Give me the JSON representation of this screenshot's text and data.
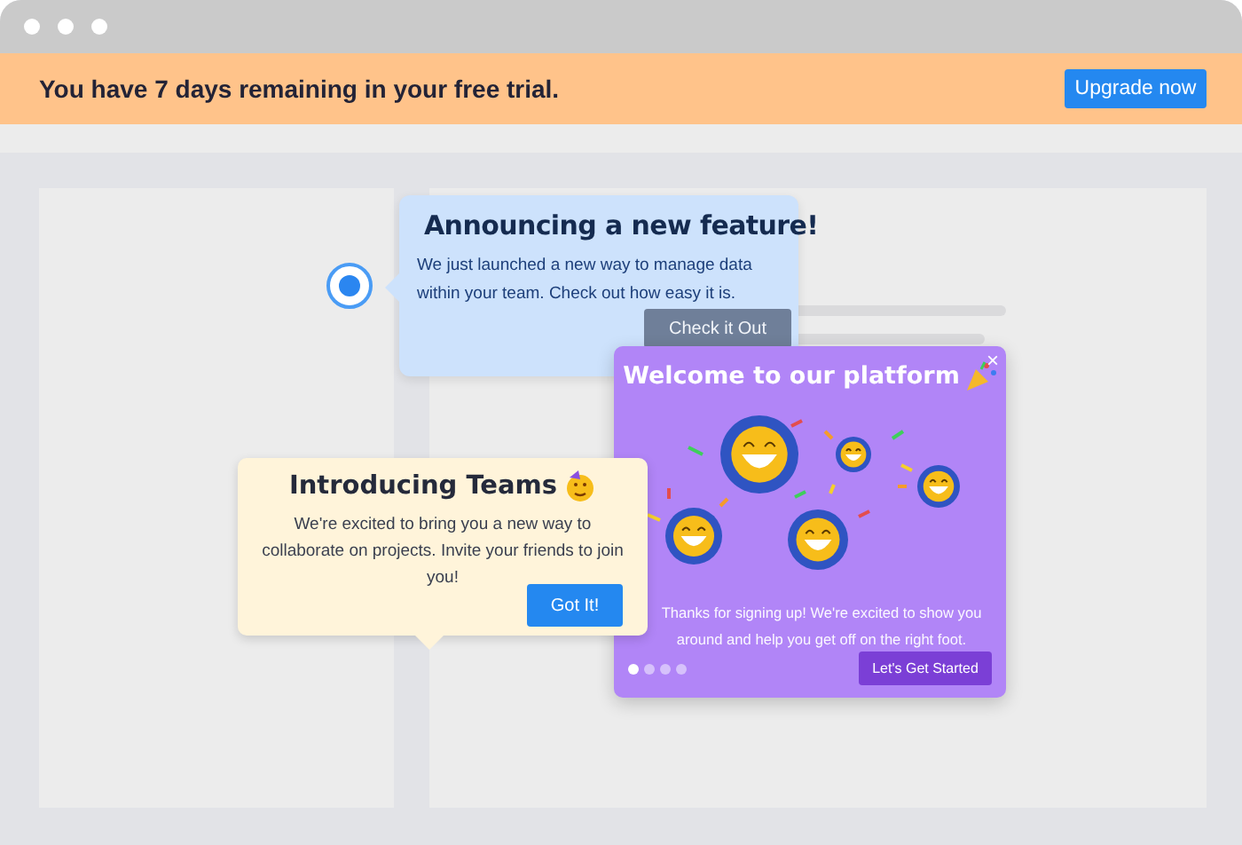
{
  "banner": {
    "message": "You have 7 days remaining in your free trial.",
    "button": "Upgrade now"
  },
  "announcement": {
    "title": "Announcing a new feature!",
    "body": "We just launched a new way to manage data within your team. Check out how easy it is.",
    "button": "Check it Out"
  },
  "welcome": {
    "title": "Welcome to our platform",
    "close": "×",
    "body": "Thanks for signing up! We're excited to show you around and help you get off on the right foot.",
    "button": "Let's Get Started",
    "pages": [
      {
        "selected": true
      },
      {
        "selected": false
      },
      {
        "selected": false
      },
      {
        "selected": false
      }
    ]
  },
  "teams": {
    "title": "Introducing Teams",
    "body": "We're excited to bring you a new way to collaborate on projects. Invite your friends to join you!",
    "button": "Got It!"
  }
}
